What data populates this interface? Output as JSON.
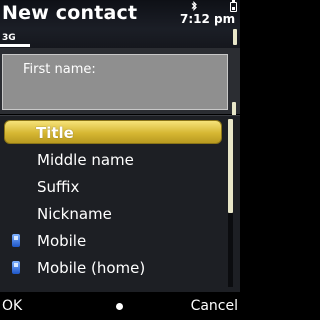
{
  "header": {
    "title": "New contact",
    "time": "7:12 pm",
    "network": "3G"
  },
  "form": {
    "field_label": "First name:",
    "field_value": ""
  },
  "popup": {
    "items": [
      {
        "label": "Title",
        "icon": "",
        "selected": true
      },
      {
        "label": "Middle name",
        "icon": "",
        "selected": false
      },
      {
        "label": "Suffix",
        "icon": "",
        "selected": false
      },
      {
        "label": "Nickname",
        "icon": "",
        "selected": false
      },
      {
        "label": "Mobile",
        "icon": "mobile-phone-icon",
        "selected": false
      },
      {
        "label": "Mobile (home)",
        "icon": "mobile-phone-icon",
        "selected": false
      }
    ]
  },
  "softkeys": {
    "left": "OK",
    "right": "Cancel"
  },
  "colors": {
    "highlight": "#d6b733",
    "field_bg": "#8f8f8f",
    "phone_icon": "#3f7ae6"
  }
}
